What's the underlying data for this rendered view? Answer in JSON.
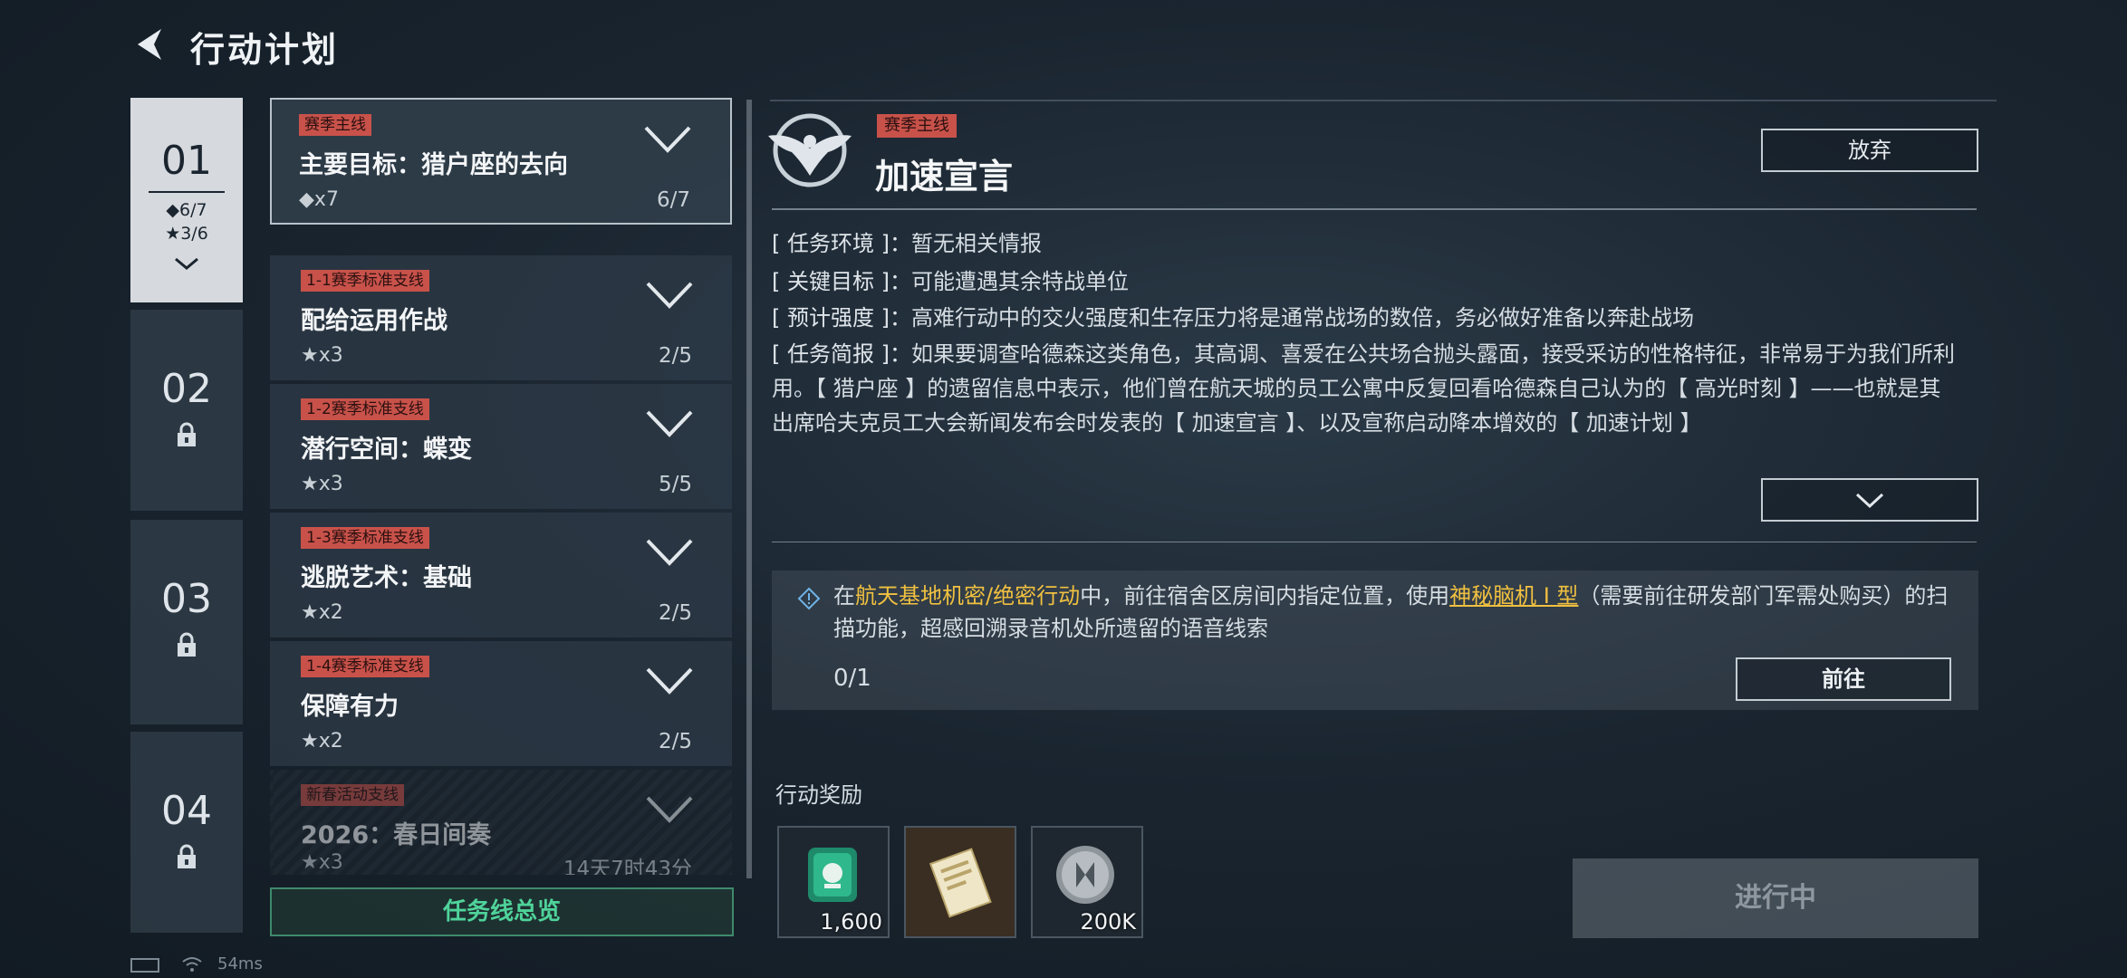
{
  "header": {
    "title": "行动计划"
  },
  "chapters": [
    {
      "num": "01",
      "stat_diamond": "◆6/7",
      "stat_star": "★3/6",
      "locked": false
    },
    {
      "num": "02",
      "locked": true
    },
    {
      "num": "03",
      "locked": true
    },
    {
      "num": "04",
      "locked": true
    }
  ],
  "quests": [
    {
      "tag": "赛季主线",
      "name": "主要目标：猎户座的去向",
      "reward": "◆x7",
      "progress": "6/7"
    },
    {
      "tag": "1-1赛季标准支线",
      "name": "配给运用作战",
      "reward": "★x3",
      "progress": "2/5"
    },
    {
      "tag": "1-2赛季标准支线",
      "name": "潜行空间：蝶变",
      "reward": "★x3",
      "progress": "5/5"
    },
    {
      "tag": "1-3赛季标准支线",
      "name": "逃脱艺术：基础",
      "reward": "★x2",
      "progress": "2/5"
    },
    {
      "tag": "1-4赛季标准支线",
      "name": "保障有力",
      "reward": "★x2",
      "progress": "2/5"
    },
    {
      "tag": "新春活动支线",
      "name": "2026：春日间奏",
      "reward": "★x3",
      "progress": "14天7时43分"
    }
  ],
  "overview_label": "任务线总览",
  "detail": {
    "tag": "赛季主线",
    "title": "加速宣言",
    "abandon_label": "放弃",
    "env_key": "[ 任务环境 ]：",
    "env_val": "暂无相关情报",
    "goal_key": "[ 关键目标 ]：",
    "goal_val": "可能遭遇其余特战单位",
    "intensity_key": "[ 预计强度 ]：",
    "intensity_val": "高难行动中的交火强度和生存压力将是通常战场的数倍，务必做好准备以奔赴战场",
    "brief_key": "[ 任务简报 ]：",
    "brief_val": "如果要调查哈德森这类角色，其高调、喜爱在公共场合抛头露面，接受采访的性格特征，非常易于为我们所利用。【 猎户座 】的遗留信息中表示，他们曾在航天城的员工公寓中反复回看哈德森自己认为的【 高光时刻 】——也就是其出席哈夫克员工大会新闻发布会时发表的【 加速宣言 】、以及宣称启动降本增效的【 加速计划 】"
  },
  "task": {
    "prefix": "在",
    "location": "航天基地机密/绝密行动",
    "mid": "中，前往宿舍区房间内指定位置，使用",
    "item": "神秘脑机 I 型",
    "suffix": "（需要前往研发部门军需处购买）的扫描功能，超感回溯录音机处所遗留的语音线索",
    "progress": "0/1",
    "go_label": "前往"
  },
  "rewards": {
    "label": "行动奖励",
    "items": [
      {
        "icon": "emblem-token-icon",
        "qty": "1,600"
      },
      {
        "icon": "document-card-icon",
        "qty": ""
      },
      {
        "icon": "silver-coin-icon",
        "qty": "200K"
      }
    ]
  },
  "progress_label": "进行中",
  "status": {
    "ping": "54ms"
  },
  "colors": {
    "tag_red": "#c8524a",
    "highlight": "#f0c040",
    "overview_green": "#4fd39a"
  }
}
